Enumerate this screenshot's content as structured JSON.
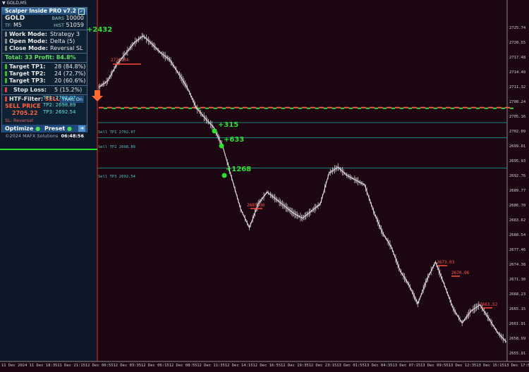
{
  "window": {
    "symbol_label": "▼ GOLD,M5"
  },
  "panel": {
    "title": "Scalper Inside PRO v7.2",
    "symbol": "GOLD",
    "bars_label": "BARS",
    "bars_value": "10000",
    "tf_label": "TF:",
    "tf_value": "M5",
    "hist_label": "HIST",
    "hist_value": "51059",
    "work_mode_label": "Work Mode:",
    "work_mode_value": "Strategy 3",
    "open_mode_label": "Open Mode:",
    "open_mode_value": "Delta (5)",
    "close_mode_label": "Close Mode:",
    "close_mode_value": "Reversal SL",
    "total_text": "Total: 33  Profit: 84.8%",
    "tp1_label": "Target TP1:",
    "tp1_value": "28 (84.8%)",
    "tp2_label": "Target TP2:",
    "tp2_value": "24 (72.7%)",
    "tp3_label": "Target TP3:",
    "tp3_value": "20 (60.6%)",
    "sl_label": "Stop Loss:",
    "sl_value": "5 (15.2%)",
    "htf_label": "HTF-Filter:",
    "htf_value": "SELL",
    "trail_label": "TRAIL On",
    "sell_price_label": "SELL PRICE",
    "sell_price_value": "2705.22",
    "sl_reversal": "SL: Reversal",
    "tp1_price": "TP1: 2702.07",
    "tp2_price": "TP2: 2698.89",
    "tp3_price": "TP3: 2692.54",
    "optimize_label": "Optimize",
    "preset_label": "Preset",
    "copyright": "©2024 MAFX Solutions",
    "timer": "06:48:56"
  },
  "chart_data": {
    "type": "line",
    "symbol": "GOLD",
    "timeframe": "M5",
    "ylim": [
      2653.85,
      2725.74
    ],
    "yticks": [
      "2725.74",
      "2720.55",
      "2717.48",
      "2714.40",
      "2711.32",
      "2708.24",
      "2705.16",
      "2702.09",
      "2699.01",
      "2695.93",
      "2692.76",
      "2689.77",
      "2686.70",
      "2683.62",
      "2680.54",
      "2677.46",
      "2674.38",
      "2671.30",
      "2668.23",
      "2665.15",
      "2661.91",
      "2658.99",
      "2655.91"
    ],
    "xticks": [
      "11 Dec 2024",
      "11 Dec 18:35",
      "11 Dec 21:15",
      "12 Dec 00:55",
      "12 Dec 03:35",
      "12 Dec 06:15",
      "12 Dec 08:55",
      "12 Dec 11:35",
      "12 Dec 14:15",
      "12 Dec 16:55",
      "12 Dec 19:35",
      "12 Dec 23:15",
      "13 Dec 01:55",
      "13 Dec 04:35",
      "13 Dec 07:15",
      "13 Dec 09:55",
      "13 Dec 12:35",
      "13 Dec 15:15",
      "13 Dec 17:55"
    ],
    "price_path": [
      2709.5,
      2710.8,
      2714.2,
      2716.5,
      2718.8,
      2720.3,
      2718.6,
      2716.7,
      2715.3,
      2712.4,
      2709.4,
      2705.2,
      2703.0,
      2701.0,
      2697.0,
      2690.5,
      2684.0,
      2680.0,
      2685.0,
      2687.5,
      2686.0,
      2684.5,
      2683.0,
      2682.0,
      2683.5,
      2685.0,
      2691.5,
      2692.7,
      2691.0,
      2690.0,
      2689.0,
      2683.5,
      2679.0,
      2676.0,
      2671.0,
      2668.0,
      2664.0,
      2669.0,
      2672.8,
      2668.0,
      2663.0,
      2660.0,
      2662.5,
      2663.8,
      2661.0,
      2658.0,
      2656.0
    ],
    "entry_level": "2705.22",
    "tp_lines": [
      {
        "label": "Sell TP1 2702.07",
        "value": 2702.07,
        "profit": "+315"
      },
      {
        "label": "Sell TP2 2698.89",
        "value": 2698.89,
        "profit": "+633"
      },
      {
        "label": "Sell TP3 2692.54",
        "value": 2692.54,
        "profit": "+1268"
      }
    ],
    "prev_profit": "+2432",
    "peak_labels": [
      "2716.34",
      "2685.36",
      "2673.03",
      "2670.96",
      "2663.52"
    ]
  },
  "colors": {
    "bg": "#1c0612",
    "prev_bg": "#0f1828",
    "price": "#e6e6e6",
    "tp_line": "#1f7f7f",
    "sell_level": "#ff5a3c",
    "green": "#2ee02e"
  }
}
